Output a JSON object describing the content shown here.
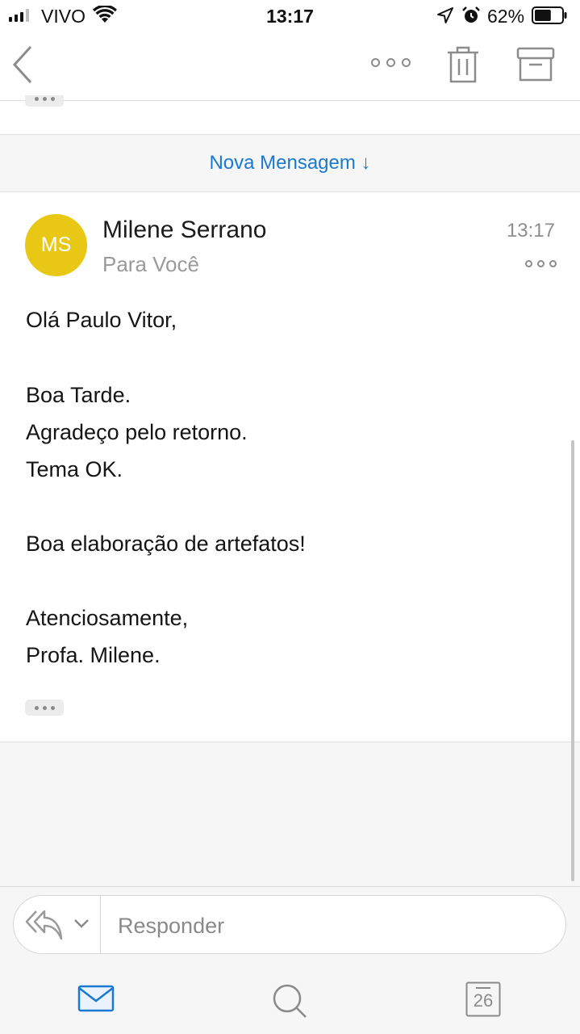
{
  "status_bar": {
    "carrier": "VIVO",
    "time": "13:17",
    "battery_percent": "62%",
    "battery_level": 0.62,
    "signal_bars": 3
  },
  "nav": {
    "back_icon": "chevron-left-icon",
    "more_icon": "more-horizontal-icon",
    "trash_icon": "trash-icon",
    "archive_icon": "archive-icon"
  },
  "banner": {
    "text": "Nova Mensagem ↓",
    "color": "#1a79d0"
  },
  "message": {
    "avatar_initials": "MS",
    "avatar_color": "#e8c814",
    "sender": "Milene Serrano",
    "to": "Para Você",
    "time": "13:17",
    "body": [
      "Olá Paulo Vitor,",
      "Boa Tarde.",
      "Agradeço pelo retorno.",
      "Tema OK.",
      "Boa elaboração de artefatos!",
      "Atenciosamente,",
      "Profa. Milene."
    ]
  },
  "reply": {
    "placeholder": "Responder"
  },
  "tabbar": {
    "mail_icon": "mail-icon",
    "search_icon": "search-icon",
    "calendar_day": "26",
    "active_color": "#1a79d0"
  }
}
